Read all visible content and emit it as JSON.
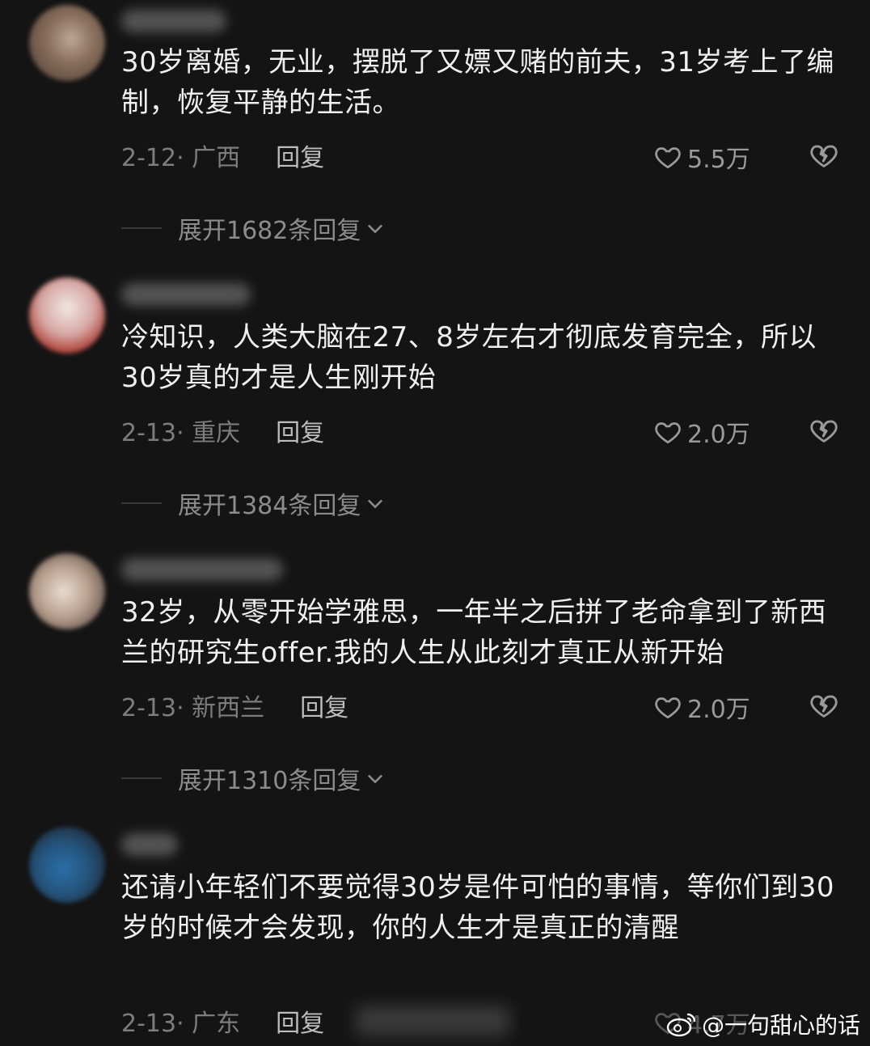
{
  "comments": [
    {
      "text": "30岁离婚，无业，摆脱了又嫖又赌的前夫，31岁考上了编制，恢复平静的生活。",
      "date": "2-12",
      "location": "广西",
      "reply_label": "回复",
      "likes": "5.5万",
      "expand": "展开1682条回复"
    },
    {
      "text": "冷知识，人类大脑在27、8岁左右才彻底发育完全，所以30岁真的才是人生刚开始",
      "date": "2-13",
      "location": "重庆",
      "reply_label": "回复",
      "likes": "2.0万",
      "expand": "展开1384条回复"
    },
    {
      "text": "32岁，从零开始学雅思，一年半之后拼了老命拿到了新西兰的研究生offer.我的人生从此刻才真正从新开始",
      "date": "2-13",
      "location": "新西兰",
      "reply_label": "回复",
      "likes": "2.0万",
      "expand": "展开1310条回复"
    },
    {
      "text": "还请小年轻们不要觉得30岁是件可怕的事情，等你们到30岁的时候才会发现，你的人生才是真正的清醒",
      "date": "2-13",
      "location": "广东",
      "reply_label": "回复",
      "likes": "4.7万"
    }
  ],
  "watermark": "@一句甜心的话",
  "icons": {
    "like": "heart-icon",
    "dislike": "broken-heart-icon",
    "expand": "chevron-down-icon",
    "watermark": "weibo-logo-icon"
  }
}
